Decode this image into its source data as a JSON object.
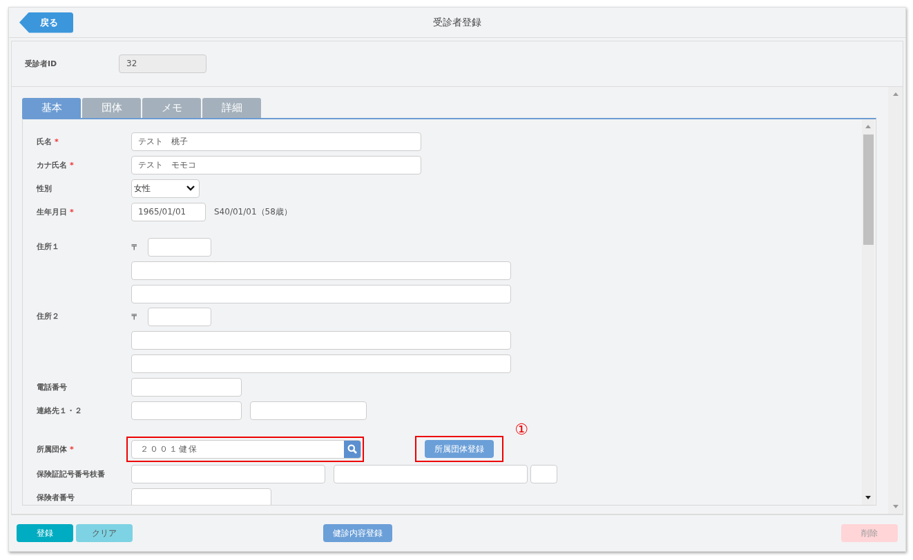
{
  "header": {
    "back_button": "戻る",
    "title": "受診者登録"
  },
  "id_field": {
    "label": "受診者ID",
    "value": "32"
  },
  "tabs": [
    {
      "label": "基本",
      "selected": true
    },
    {
      "label": "団体",
      "selected": false
    },
    {
      "label": "メモ",
      "selected": false
    },
    {
      "label": "詳細",
      "selected": false
    }
  ],
  "form_rows": [
    {
      "kind": "name",
      "label": "氏名",
      "required_mark": "*",
      "value": "テスト　桃子"
    },
    {
      "kind": "name",
      "label": "カナ氏名",
      "required_mark": "*",
      "value": "テスト　モモコ"
    },
    {
      "kind": "select",
      "label": "性別",
      "value": "女性"
    },
    {
      "kind": "date",
      "label": "生年月日",
      "required_mark": "*",
      "value": "1965/01/01",
      "note": "S40/01/01（58歳）"
    },
    {
      "kind": "address",
      "label": "住所１",
      "postal_mark": "〒"
    },
    {
      "kind": "address",
      "label": "住所２",
      "postal_mark": "〒"
    },
    {
      "kind": "phone",
      "label": "電話番号"
    },
    {
      "kind": "contacts",
      "label": "連絡先１・２"
    },
    {
      "kind": "group",
      "label": "所属団体",
      "required_mark": "*",
      "value": "２００１健保",
      "highlighted": true,
      "button": "所属団体登録",
      "button_highlighted": true,
      "annotation": "①"
    },
    {
      "kind": "insurance_card",
      "label": "保険証記号番号枝番"
    },
    {
      "kind": "insurer",
      "label": "保険者番号"
    }
  ],
  "footer_buttons": [
    {
      "kind": "save",
      "label": "登録"
    },
    {
      "kind": "clear",
      "label": "クリア"
    },
    {
      "kind": "exam",
      "label": "健診内容登録"
    },
    {
      "kind": "delete",
      "label": "削除"
    }
  ]
}
